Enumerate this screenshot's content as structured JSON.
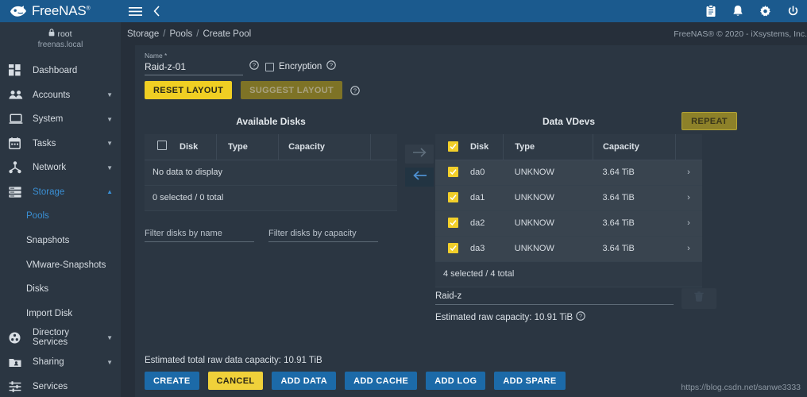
{
  "topbar": {
    "brand": "FreeNAS",
    "brand_mark": "®",
    "menu_icon": "hamburger-menu-icon",
    "back_icon": "chevron-left-icon",
    "icons": [
      "clipboard-icon",
      "bell-icon",
      "gear-icon",
      "power-icon"
    ]
  },
  "sidebar": {
    "user": "root",
    "host": "freenas.local",
    "items": [
      {
        "label": "Dashboard",
        "icon": "dashboard-icon",
        "expandable": false,
        "active": false
      },
      {
        "label": "Accounts",
        "icon": "accounts-icon",
        "expandable": true,
        "active": false
      },
      {
        "label": "System",
        "icon": "system-icon",
        "expandable": true,
        "active": false
      },
      {
        "label": "Tasks",
        "icon": "tasks-calendar-icon",
        "expandable": true,
        "active": false
      },
      {
        "label": "Network",
        "icon": "network-icon",
        "expandable": true,
        "active": false
      },
      {
        "label": "Storage",
        "icon": "storage-icon",
        "expandable": true,
        "active": true
      }
    ],
    "storage_children": [
      {
        "label": "Pools",
        "active": true
      },
      {
        "label": "Snapshots",
        "active": false
      },
      {
        "label": "VMware-Snapshots",
        "active": false
      },
      {
        "label": "Disks",
        "active": false
      },
      {
        "label": "Import Disk",
        "active": false
      }
    ],
    "items_after": [
      {
        "label": "Directory Services",
        "icon": "directory-services-icon",
        "expandable": true,
        "active": false
      },
      {
        "label": "Sharing",
        "icon": "sharing-icon",
        "expandable": true,
        "active": false
      },
      {
        "label": "Services",
        "icon": "services-sliders-icon",
        "expandable": false,
        "active": false
      }
    ]
  },
  "breadcrumb": {
    "items": [
      "Storage",
      "Pools",
      "Create Pool"
    ],
    "separator": "/"
  },
  "copyright": "FreeNAS® © 2020 - iXsystems, Inc.",
  "form": {
    "name_label": "Name *",
    "name_value": "Raid-z-01",
    "name_help_icon": "help-circle-icon",
    "encryption_label": "Encryption",
    "encryption_checked": false,
    "encryption_help_icon": "help-circle-icon",
    "reset_layout_label": "RESET LAYOUT",
    "suggest_layout_label": "SUGGEST LAYOUT",
    "layout_help_icon": "help-circle-icon"
  },
  "available_disks": {
    "title": "Available Disks",
    "columns": [
      "",
      "Disk",
      "Type",
      "Capacity",
      ""
    ],
    "header_checkbox_checked": false,
    "empty_message": "No data to display",
    "count_text": "0 selected / 0 total",
    "filters": [
      {
        "placeholder": "Filter disks by name",
        "value": ""
      },
      {
        "placeholder": "Filter disks by capacity",
        "value": ""
      }
    ]
  },
  "transfer": {
    "to_right_icon": "arrow-right-icon",
    "to_left_icon": "arrow-left-icon"
  },
  "data_vdevs": {
    "title": "Data VDevs",
    "repeat_label": "REPEAT",
    "columns": [
      "",
      "Disk",
      "Type",
      "Capacity",
      ""
    ],
    "header_checkbox_checked": true,
    "rows": [
      {
        "checked": true,
        "disk": "da0",
        "type": "UNKNOW",
        "capacity": "3.64 TiB",
        "expand_icon": "chevron-right-icon"
      },
      {
        "checked": true,
        "disk": "da1",
        "type": "UNKNOW",
        "capacity": "3.64 TiB",
        "expand_icon": "chevron-right-icon"
      },
      {
        "checked": true,
        "disk": "da2",
        "type": "UNKNOW",
        "capacity": "3.64 TiB",
        "expand_icon": "chevron-right-icon"
      },
      {
        "checked": true,
        "disk": "da3",
        "type": "UNKNOW",
        "capacity": "3.64 TiB",
        "expand_icon": "chevron-right-icon"
      }
    ],
    "count_text": "4 selected / 4 total",
    "raidz_value": "Raid-z",
    "raidz_caret_icon": "chevron-down-icon",
    "raidz_capacity_text": "Estimated raw capacity: 10.91 TiB",
    "raidz_help_icon": "help-circle-icon",
    "delete_icon": "trash-icon"
  },
  "footer": {
    "total_capacity": "Estimated total raw data capacity: 10.91 TiB",
    "buttons": [
      {
        "label": "CREATE",
        "style": "blue"
      },
      {
        "label": "CANCEL",
        "style": "gold"
      },
      {
        "label": "ADD DATA",
        "style": "blue"
      },
      {
        "label": "ADD CACHE",
        "style": "blue"
      },
      {
        "label": "ADD LOG",
        "style": "blue"
      },
      {
        "label": "ADD SPARE",
        "style": "blue"
      }
    ]
  },
  "watermark": "https://blog.csdn.net/sanwe3333",
  "colors": {
    "topbar": "#1b5a8e",
    "sidebar": "#2b3642",
    "page_bg": "#262f3a",
    "card": "#2b3642",
    "accent_yellow": "#f0cf23",
    "accent_blue": "#1c6aa8",
    "active_link": "#3a8fd4"
  }
}
